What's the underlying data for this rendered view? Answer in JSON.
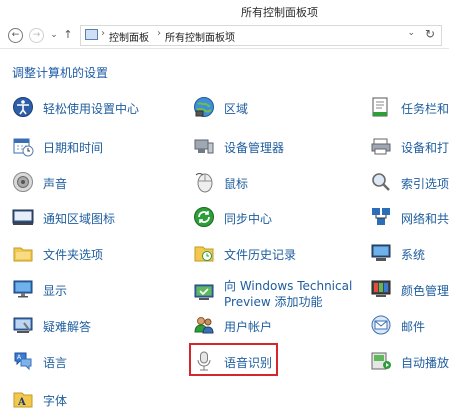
{
  "window": {
    "title": "所有控制面板项"
  },
  "nav": {
    "back_label": "←",
    "forward_label": "→",
    "recent_label": "⌄",
    "up_label": "↑",
    "breadcrumb": [
      "控制面板",
      "所有控制面板项"
    ],
    "separator": "›",
    "dropdown_label": "⌄",
    "refresh_label": "↻"
  },
  "main": {
    "heading": "调整计算机的设置",
    "items": [
      {
        "label": "轻松使用设置中心",
        "icon": "ease-of-access-icon"
      },
      {
        "label": "区域",
        "icon": "region-globe-icon"
      },
      {
        "label": "任务栏和",
        "icon": "taskbar-icon"
      },
      {
        "label": "日期和时间",
        "icon": "calendar-clock-icon"
      },
      {
        "label": "设备管理器",
        "icon": "device-manager-icon"
      },
      {
        "label": "设备和打",
        "icon": "devices-printers-icon"
      },
      {
        "label": "声音",
        "icon": "speaker-icon"
      },
      {
        "label": "鼠标",
        "icon": "mouse-icon"
      },
      {
        "label": "索引选项",
        "icon": "indexing-icon"
      },
      {
        "label": "通知区域图标",
        "icon": "notification-area-icon"
      },
      {
        "label": "同步中心",
        "icon": "sync-center-icon"
      },
      {
        "label": "网络和共",
        "icon": "network-sharing-icon"
      },
      {
        "label": "文件夹选项",
        "icon": "folder-options-icon"
      },
      {
        "label": "文件历史记录",
        "icon": "file-history-icon"
      },
      {
        "label": "系统",
        "icon": "system-icon"
      },
      {
        "label": "显示",
        "icon": "display-icon"
      },
      {
        "label": "向 Windows Technical",
        "label_line2": "Preview 添加功能",
        "icon": "add-features-icon"
      },
      {
        "label": "颜色管理",
        "icon": "color-management-icon"
      },
      {
        "label": "疑难解答",
        "icon": "troubleshooting-icon"
      },
      {
        "label": "用户帐户",
        "icon": "user-accounts-icon"
      },
      {
        "label": "邮件",
        "icon": "mail-icon"
      },
      {
        "label": "语言",
        "icon": "language-icon"
      },
      {
        "label": "语音识别",
        "icon": "microphone-icon"
      },
      {
        "label": "自动播放",
        "icon": "autoplay-icon"
      },
      {
        "label": "字体",
        "icon": "fonts-icon"
      }
    ]
  },
  "colors": {
    "link": "#1e5d9e",
    "heading": "#1d5aa8",
    "highlight_border": "#d4272b"
  }
}
